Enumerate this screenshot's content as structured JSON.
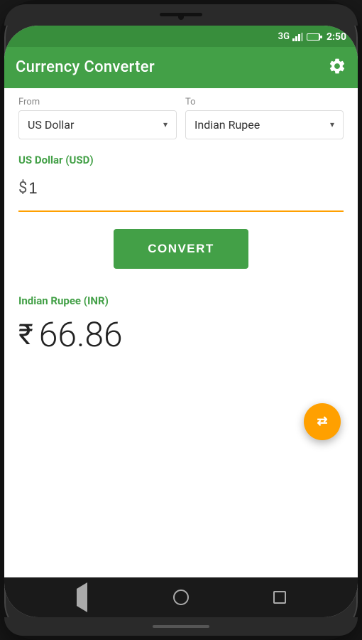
{
  "statusBar": {
    "signal": "3G",
    "battery": "🔋",
    "time": "2:50"
  },
  "header": {
    "title": "Currency Converter",
    "settingsLabel": "Settings"
  },
  "from": {
    "label": "From",
    "selected": "US Dollar",
    "arrow": "▾"
  },
  "to": {
    "label": "To",
    "selected": "Indian Rupee",
    "arrow": "▾"
  },
  "inputSection": {
    "currencyLabel": "US Dollar (USD)",
    "symbol": "$",
    "value": "1"
  },
  "convertButton": {
    "label": "CONVERT"
  },
  "resultSection": {
    "currencyLabel": "Indian Rupee (INR)",
    "symbol": "₹",
    "value": "66.86"
  },
  "fab": {
    "icon": "⇄"
  },
  "navbar": {
    "backLabel": "back",
    "homeLabel": "home",
    "recentLabel": "recent"
  }
}
